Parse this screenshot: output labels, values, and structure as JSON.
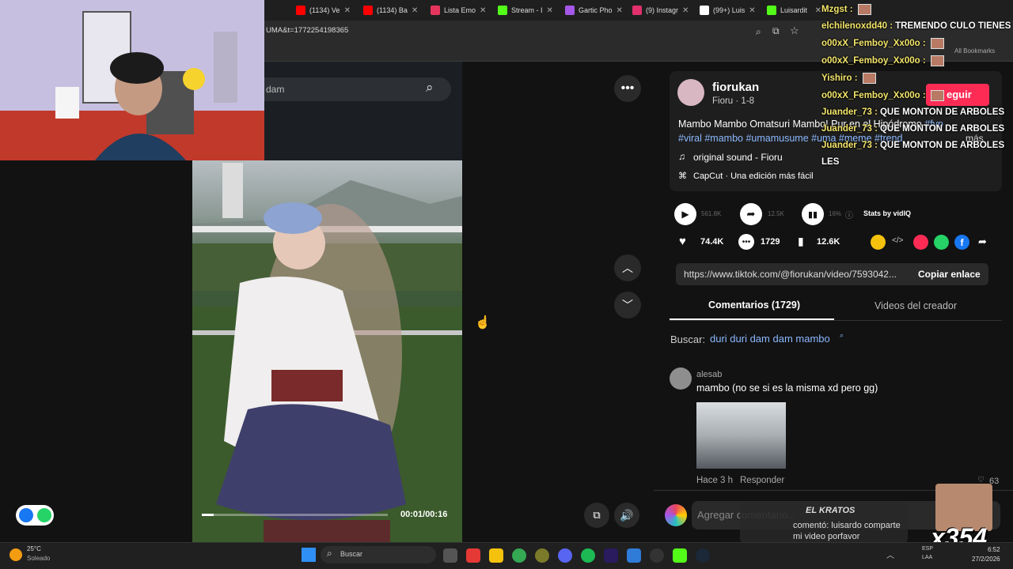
{
  "browser": {
    "tabs": [
      {
        "label": "(1134) Ve",
        "icon": "youtube-icon",
        "color": "#ff0000"
      },
      {
        "label": "(1134) Ba",
        "icon": "youtube-icon",
        "color": "#ff0000"
      },
      {
        "label": "Lista Emo",
        "icon": "bolt-icon",
        "color": "#e5355c"
      },
      {
        "label": "Stream - I",
        "icon": "kick-icon",
        "color": "#53fc18"
      },
      {
        "label": "Gartic Pho",
        "icon": "gartic-icon",
        "color": "#a457e8"
      },
      {
        "label": "(9) Instagr",
        "icon": "instagram-icon",
        "color": "#e1306c"
      },
      {
        "label": "(99+) Luis",
        "icon": "tiktok-icon",
        "color": "#ffffff"
      },
      {
        "label": "Luisardit",
        "icon": "kick-icon",
        "color": "#53fc18"
      }
    ],
    "url_fragment": "UMA&t=1772254198365",
    "bookmarks_label": "All Bookmarks"
  },
  "video": {
    "search_placeholder": "dam",
    "time": "00:01/00:16",
    "progress": 0.0625
  },
  "post": {
    "username": "fiorukan",
    "subline": "Fioru · 1-8",
    "follow_label": "eguir",
    "caption": "Mambo Mambo Omatsuri Mambo! Pur en el Hipódromo",
    "caption_tag_end": "#fyp",
    "hashtags": "#viral #mambo #umamusume #uma #meme #trend",
    "more_label": "más",
    "sound": "original sound - Fioru",
    "capcut": "CapCut · Una edición más fácil",
    "stats": {
      "plays": "561.8K",
      "shares": "12.5K",
      "percent": "16%",
      "stats_label": "Stats by vidIQ"
    },
    "likes": "74.4K",
    "comments": "1729",
    "saves": "12.6K",
    "link": "https://www.tiktok.com/@fiorukan/video/7593042...",
    "copy_label": "Copiar enlace",
    "tab_comments": "Comentarios (1729)",
    "tab_videos": "Videos del creador",
    "search_prefix": "Buscar:",
    "search_query": "duri duri dam dam mambo"
  },
  "comment": {
    "author": "alesab",
    "text": "mambo (no se si es la misma xd pero gg)",
    "time": "Hace 3 h",
    "reply_label": "Responder",
    "likes": "63"
  },
  "comment_input": {
    "placeholder": "Agregar comentario..."
  },
  "chat": [
    {
      "user": "Mzgst :",
      "msg": ""
    },
    {
      "user": "elchilenoxdd40 :",
      "msg": "TREMENDO CULO TIENES"
    },
    {
      "user": "o00xX_Femboy_Xx00o :",
      "msg": ""
    },
    {
      "user": "o00xX_Femboy_Xx00o :",
      "msg": ""
    },
    {
      "user": "Yishiro :",
      "msg": ""
    },
    {
      "user": "o00xX_Femboy_Xx00o :",
      "msg": ""
    },
    {
      "user": "Juander_73 :",
      "msg": "QUE MONTON DE ARBOLES"
    },
    {
      "user": "Juander_73 :",
      "msg": "QUE MONTON DE ARBOLES"
    },
    {
      "user": "Juander_73 :",
      "msg": "QUE MONTON DE ARBOLES"
    },
    {
      "user": "",
      "msg": "LES"
    }
  ],
  "alert": {
    "name": "EL KRATOS",
    "text": "comentó: luisardo comparte mi video porfavor",
    "multiplier": "x354"
  },
  "taskbar": {
    "weather_temp": "25°C",
    "weather_desc": "Soleado",
    "search_label": "Buscar",
    "lang": "ESP",
    "lang2": "LAA",
    "time": "6:52",
    "date": "27/2/2026"
  }
}
